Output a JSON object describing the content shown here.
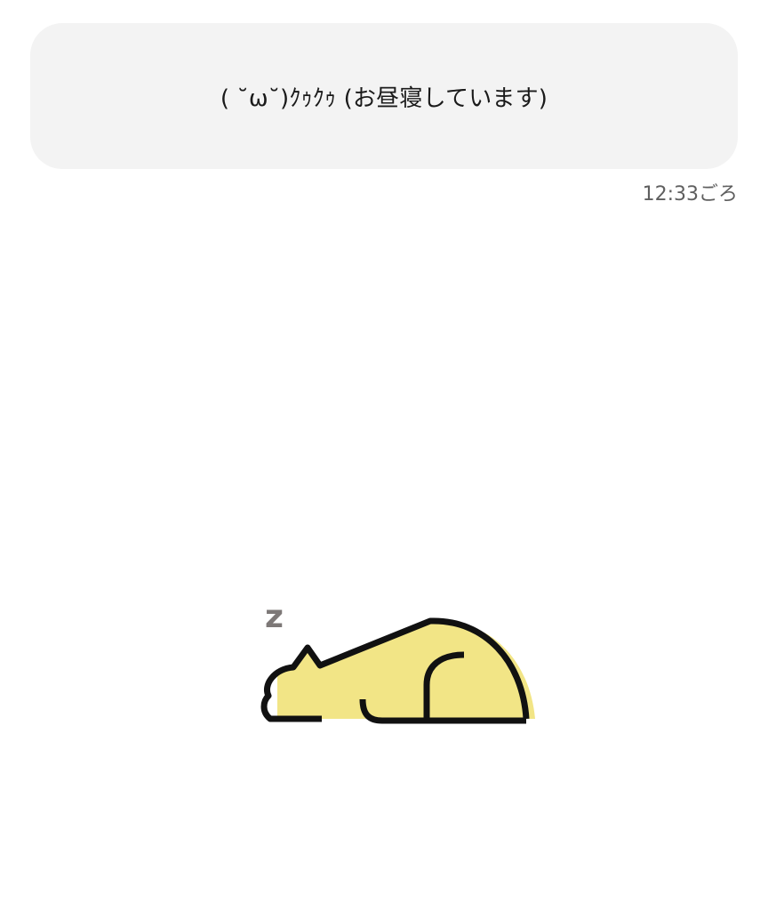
{
  "status": {
    "message": "( ˘ω˘)ｸｩｸｩ (お昼寝しています)",
    "time": "12:33ごろ"
  },
  "illustration": {
    "icon": "sleeping-cat-icon",
    "zz_icon": "sleep-z-icon",
    "sleep_glyph": "z",
    "colors": {
      "body_fill": "#f2e586",
      "outline": "#111111",
      "z_color": "#7d7877"
    }
  }
}
